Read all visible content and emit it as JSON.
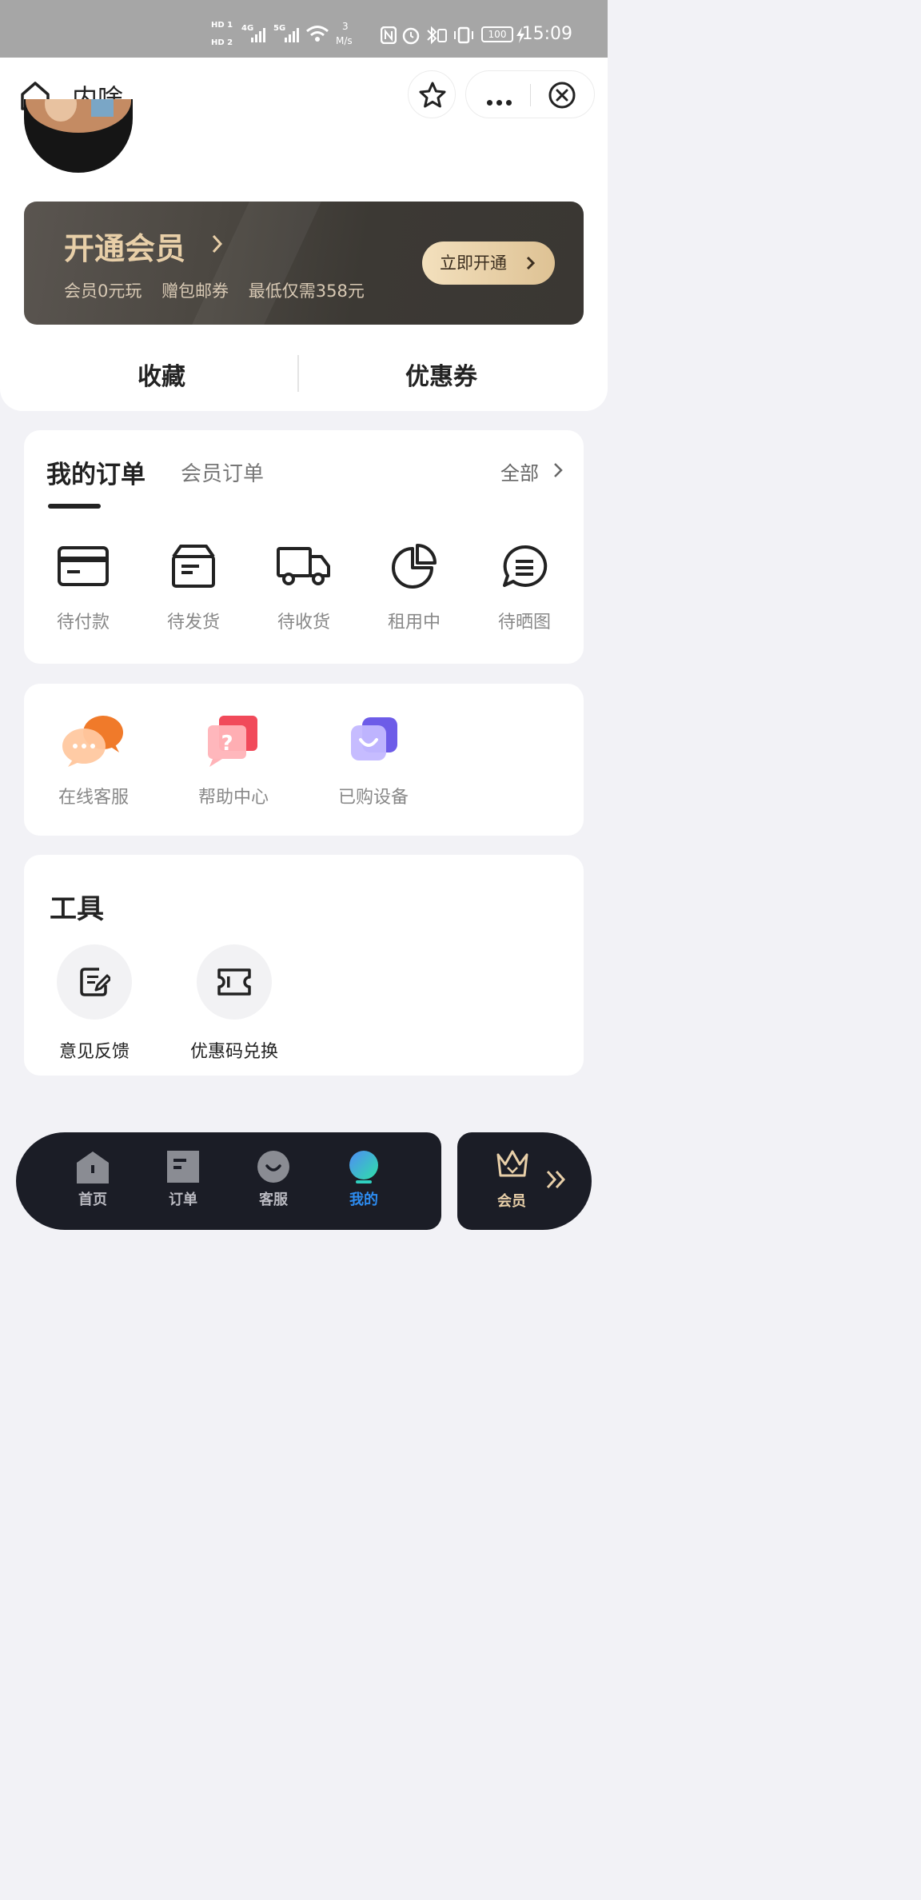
{
  "status_bar": {
    "network_hd1": "HD 1",
    "network_hd2": "HD 2",
    "sim1_type": "4G",
    "sim2_type": "5G",
    "speed_value": "3",
    "speed_unit": "M/s",
    "battery": "100",
    "time": "15:09"
  },
  "navbar": {
    "title": "内啥"
  },
  "vip_banner": {
    "title": "开通会员",
    "perks": [
      "会员0元玩",
      "赠包邮券",
      "最低仅需358元"
    ],
    "button_label": "立即开通"
  },
  "quick_links": [
    {
      "label": "收藏"
    },
    {
      "label": "优惠券"
    }
  ],
  "orders": {
    "tab_active": "我的订单",
    "tab_other": "会员订单",
    "see_all": "全部",
    "items": [
      {
        "label": "待付款",
        "icon": "card-icon"
      },
      {
        "label": "待发货",
        "icon": "box-icon"
      },
      {
        "label": "待收货",
        "icon": "truck-icon"
      },
      {
        "label": "租用中",
        "icon": "pie-icon"
      },
      {
        "label": "待晒图",
        "icon": "comment-icon"
      }
    ]
  },
  "services": {
    "items": [
      {
        "label": "在线客服",
        "icon": "chat-bubbles-icon"
      },
      {
        "label": "帮助中心",
        "icon": "help-icon"
      },
      {
        "label": "已购设备",
        "icon": "device-icon"
      }
    ]
  },
  "tools": {
    "title": "工具",
    "items": [
      {
        "label": "意见反馈",
        "icon": "feedback-icon"
      },
      {
        "label": "优惠码兑换",
        "icon": "ticket-icon"
      }
    ]
  },
  "tabbar": {
    "items": [
      {
        "label": "首页",
        "icon": "home-icon",
        "active": false
      },
      {
        "label": "订单",
        "icon": "order-icon",
        "active": false
      },
      {
        "label": "客服",
        "icon": "service-icon",
        "active": false
      },
      {
        "label": "我的",
        "icon": "profile-icon",
        "active": true
      }
    ],
    "vip_label": "会员"
  },
  "colors": {
    "accent_active": "#2d8cf0",
    "vip_gold": "#e8cfa8",
    "tabbar_bg": "#1b1d26"
  }
}
